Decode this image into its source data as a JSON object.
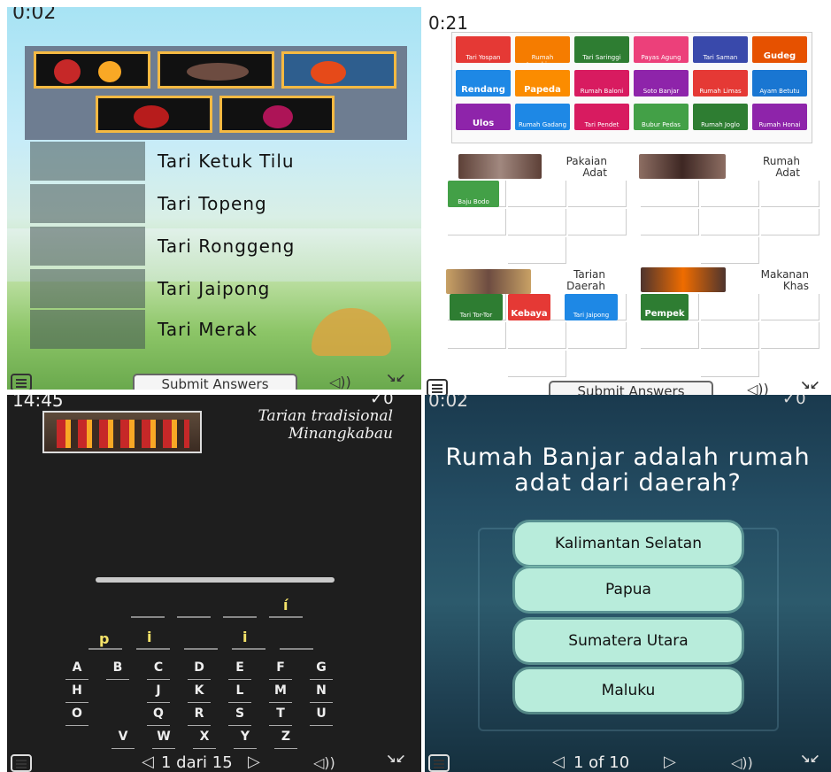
{
  "p1": {
    "timer": "0:02",
    "labels": [
      "Tari Ketuk Tilu",
      "Tari Topeng",
      "Tari Ronggeng",
      "Tari Jaipong",
      "Tari Merak"
    ],
    "submit": "Submit Answers"
  },
  "p2": {
    "timer": "0:21",
    "bank": [
      {
        "label": "Tari Yospan",
        "color": "#e53935"
      },
      {
        "label": "Rumah Lengkiong",
        "color": "#f57c00"
      },
      {
        "label": "Tari Saringgi",
        "color": "#2e7d32"
      },
      {
        "label": "Payas Agung",
        "color": "#ec407a"
      },
      {
        "label": "Tari Saman",
        "color": "#3949ab"
      },
      {
        "label": "Gudeg",
        "color": "#e65100"
      },
      {
        "label": "Rendang",
        "color": "#1e88e5"
      },
      {
        "label": "Papeda",
        "color": "#fb8c00"
      },
      {
        "label": "Rumah Baloni",
        "color": "#d81b60"
      },
      {
        "label": "Soto Banjar",
        "color": "#8e24aa"
      },
      {
        "label": "Rumah Limas",
        "color": "#e53935"
      },
      {
        "label": "Ayam Betutu",
        "color": "#1976d2"
      },
      {
        "label": "Ulos",
        "color": "#8e24aa"
      },
      {
        "label": "Rumah Gadang",
        "color": "#1e88e5"
      },
      {
        "label": "Tari Pendet",
        "color": "#d81b60"
      },
      {
        "label": "Bubur Pedas",
        "color": "#43a047"
      },
      {
        "label": "Rumah Joglo",
        "color": "#2e7d32"
      },
      {
        "label": "Rumah Honai",
        "color": "#8e24aa"
      }
    ],
    "categories": [
      {
        "name": "Pakaian Adat"
      },
      {
        "name": "Rumah Adat"
      },
      {
        "name": "Tarian Daerah"
      },
      {
        "name": "Makanan Khas"
      }
    ],
    "placed": [
      {
        "label": "Baju Bodo",
        "color": "#43a047"
      },
      {
        "label": "Tari Tor-Tor",
        "color": "#2e7d32"
      },
      {
        "label": "Kebaya",
        "color": "#e53935"
      },
      {
        "label": "Tari Jaipong",
        "color": "#1e88e5"
      },
      {
        "label": "Pempek",
        "color": "#2e7d32"
      }
    ],
    "submit": "Submit Answers"
  },
  "p3": {
    "timer": "14:45",
    "score": "✓0",
    "title": "Tarian tradisional Minangkabau",
    "letters_row1": [
      "í"
    ],
    "letters_row2": [
      "p",
      "i",
      "i"
    ],
    "keys": [
      [
        "A",
        "B",
        "C",
        "D",
        "E",
        "F",
        "G"
      ],
      [
        "H",
        "",
        "J",
        "K",
        "L",
        "M",
        "N"
      ],
      [
        "O",
        "",
        "Q",
        "R",
        "S",
        "T",
        "U"
      ],
      [
        "V",
        "W",
        "X",
        "Y",
        "Z"
      ]
    ],
    "pager": "1 dari 15"
  },
  "p4": {
    "timer": "0:02",
    "score": "✓0",
    "question": "Rumah Banjar adalah rumah adat dari daerah?",
    "answers": [
      "Kalimantan Selatan",
      "Papua",
      "Sumatera Utara",
      "Maluku"
    ],
    "pager": "1 of 10"
  }
}
